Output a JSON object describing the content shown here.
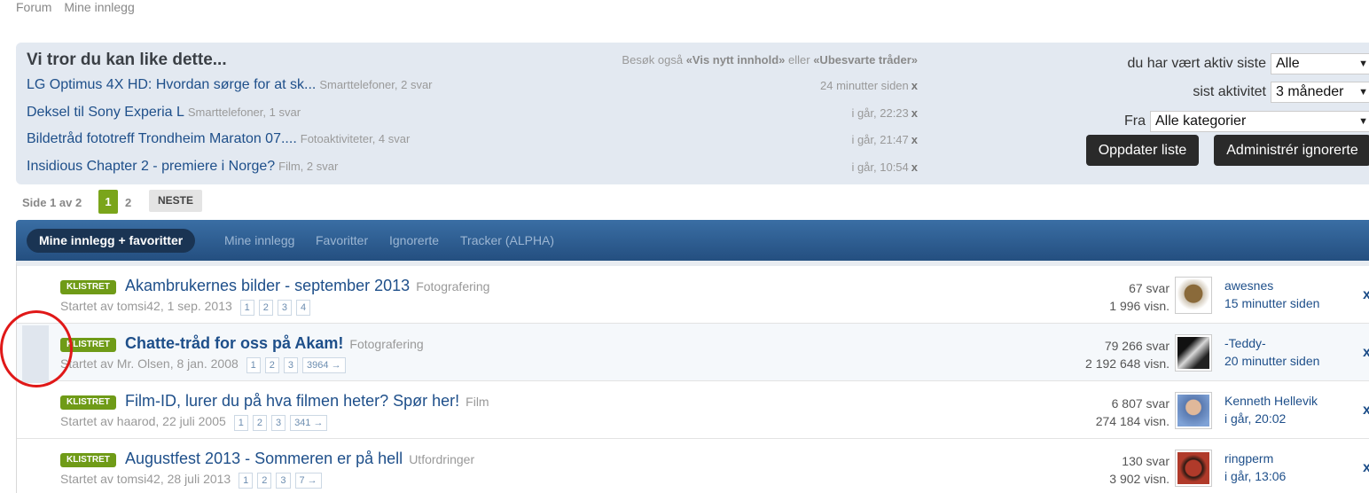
{
  "breadcrumb": {
    "forum": "Forum",
    "mine": "Mine innlegg"
  },
  "suggest": {
    "title": "Vi tror du kan like dette...",
    "hint_pre": "Besøk også ",
    "hint_link1": "«Vis nytt innhold»",
    "hint_mid": " eller ",
    "hint_link2": "«Ubesvarte tråder»",
    "items": [
      {
        "title": "LG Optimus 4X HD: Hvordan sørge for at sk...",
        "meta": "Smarttelefoner, 2 svar",
        "time": "24 minutter siden"
      },
      {
        "title": "Deksel til Sony Experia L",
        "meta": "Smarttelefoner, 1 svar",
        "time": "i går, 22:23"
      },
      {
        "title": "Bildetråd fototreff Trondheim Maraton 07....",
        "meta": "Fotoaktiviteter, 4 svar",
        "time": "i går, 21:47"
      },
      {
        "title": "Insidious Chapter 2 - premiere i Norge?",
        "meta": "Film, 2 svar",
        "time": "i går, 10:54"
      }
    ],
    "dismiss": "x"
  },
  "filters": {
    "active_label": "du har vært aktiv siste",
    "active_value": "Alle",
    "since_label": "sist aktivitet",
    "since_value": "3 måneder",
    "from_label": "Fra",
    "from_value": "Alle kategorier",
    "update_button": "Oppdater liste",
    "manage_button": "Administrér ignorerte"
  },
  "pager": {
    "info": "Side 1 av 2",
    "current": "1",
    "next_page": "2",
    "next_label": "NESTE"
  },
  "tabs": {
    "active": "Mine innlegg + favoritter",
    "items": [
      "Mine innlegg",
      "Favoritter",
      "Ignorerte",
      "Tracker (ALPHA)"
    ]
  },
  "threads": [
    {
      "badge": "KLISTRET",
      "title": "Akambrukernes bilder - september 2013",
      "category": "Fotografering",
      "started": "Startet av tomsi42, 1 sep. 2013",
      "pages": [
        "1",
        "2",
        "3",
        "4"
      ],
      "replies": "67 svar",
      "views": "1 996 visn.",
      "last_user": "awesnes",
      "last_time": "15 minutter siden",
      "avatar_color": "#8a6a3a"
    },
    {
      "badge": "KLISTRET",
      "title": "Chatte-tråd for oss på Akam!",
      "category": "Fotografering",
      "started": "Startet av Mr. Olsen, 8 jan. 2008",
      "pages": [
        "1",
        "2",
        "3",
        "3964 →"
      ],
      "replies": "79 266 svar",
      "views": "2 192 648 visn.",
      "last_user": "-Teddy-",
      "last_time": "20 minutter siden",
      "avatar_color": "#3a3a3a"
    },
    {
      "badge": "KLISTRET",
      "title": "Film-ID, lurer du på hva filmen heter? Spør her!",
      "category": "Film",
      "started": "Startet av haarod, 22 juli 2005",
      "pages": [
        "1",
        "2",
        "3",
        "341 →"
      ],
      "replies": "6 807 svar",
      "views": "274 184 visn.",
      "last_user": "Kenneth Hellevik",
      "last_time": "i går, 20:02",
      "avatar_color": "#5a7ab0"
    },
    {
      "badge": "KLISTRET",
      "title": "Augustfest 2013 - Sommeren er på hell",
      "category": "Utfordringer",
      "started": "Startet av tomsi42, 28 juli 2013",
      "pages": [
        "1",
        "2",
        "3",
        "7 →"
      ],
      "replies": "130 svar",
      "views": "3 902 visn.",
      "last_user": "ringperm",
      "last_time": "i går, 13:06",
      "avatar_color": "#b03a2a"
    }
  ],
  "row_dismiss": "x"
}
